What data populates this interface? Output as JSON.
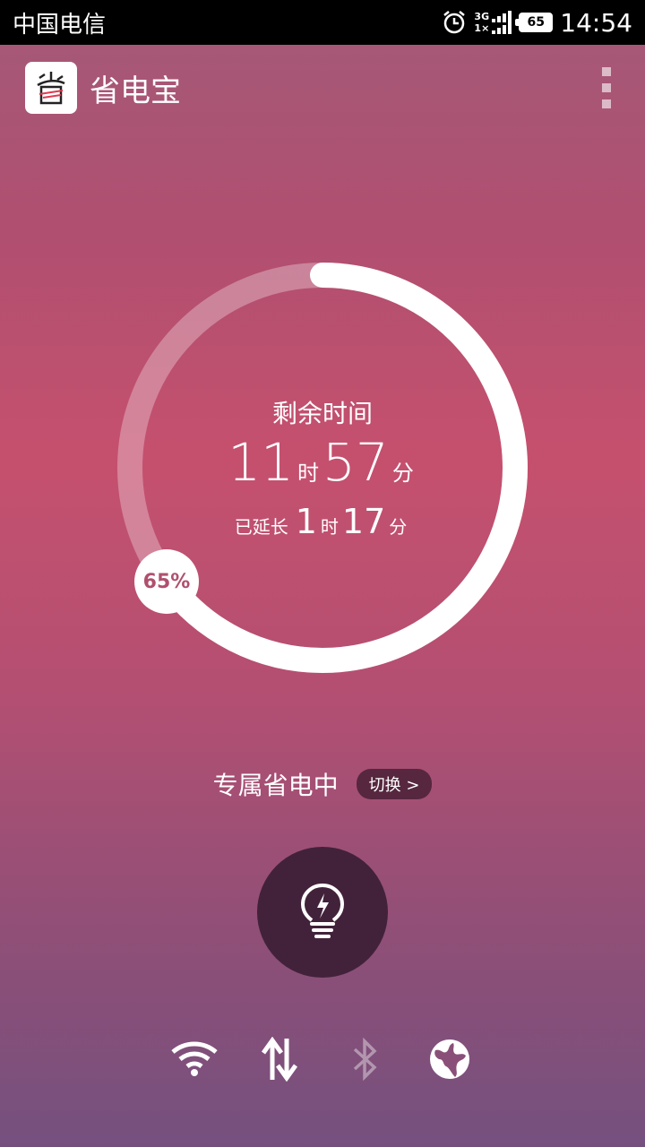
{
  "status_bar": {
    "carrier": "中国电信",
    "network_top": "3G",
    "network_bottom": "1×",
    "battery_level": "65",
    "time": "14:54",
    "icons": [
      "alarm-icon",
      "signal-icon",
      "battery-icon"
    ]
  },
  "app": {
    "title": "省电宝",
    "logo_icon": "app-logo-icon",
    "menu_icon": "overflow-menu-icon"
  },
  "battery_ring": {
    "remaining_label": "剩余时间",
    "hours": "11",
    "hours_unit": "时",
    "minutes": "57",
    "minutes_unit": "分",
    "extended_label": "已延长",
    "ext_hours": "1",
    "ext_hours_unit": "时",
    "ext_minutes": "17",
    "ext_minutes_unit": "分",
    "percent_text": "65%",
    "level": 0.65
  },
  "mode": {
    "label": "专属省电中",
    "switch_label": "切换 >"
  },
  "saver_button": {
    "icon": "lightbulb-bolt-icon"
  },
  "toggles": [
    {
      "icon": "wifi-icon",
      "state": "on"
    },
    {
      "icon": "mobile-data-icon",
      "state": "on"
    },
    {
      "icon": "bluetooth-icon",
      "state": "off"
    },
    {
      "icon": "globe-icon",
      "state": "on"
    }
  ],
  "colors": {
    "accent": "#c5506e",
    "button_dark": "#42223a"
  }
}
